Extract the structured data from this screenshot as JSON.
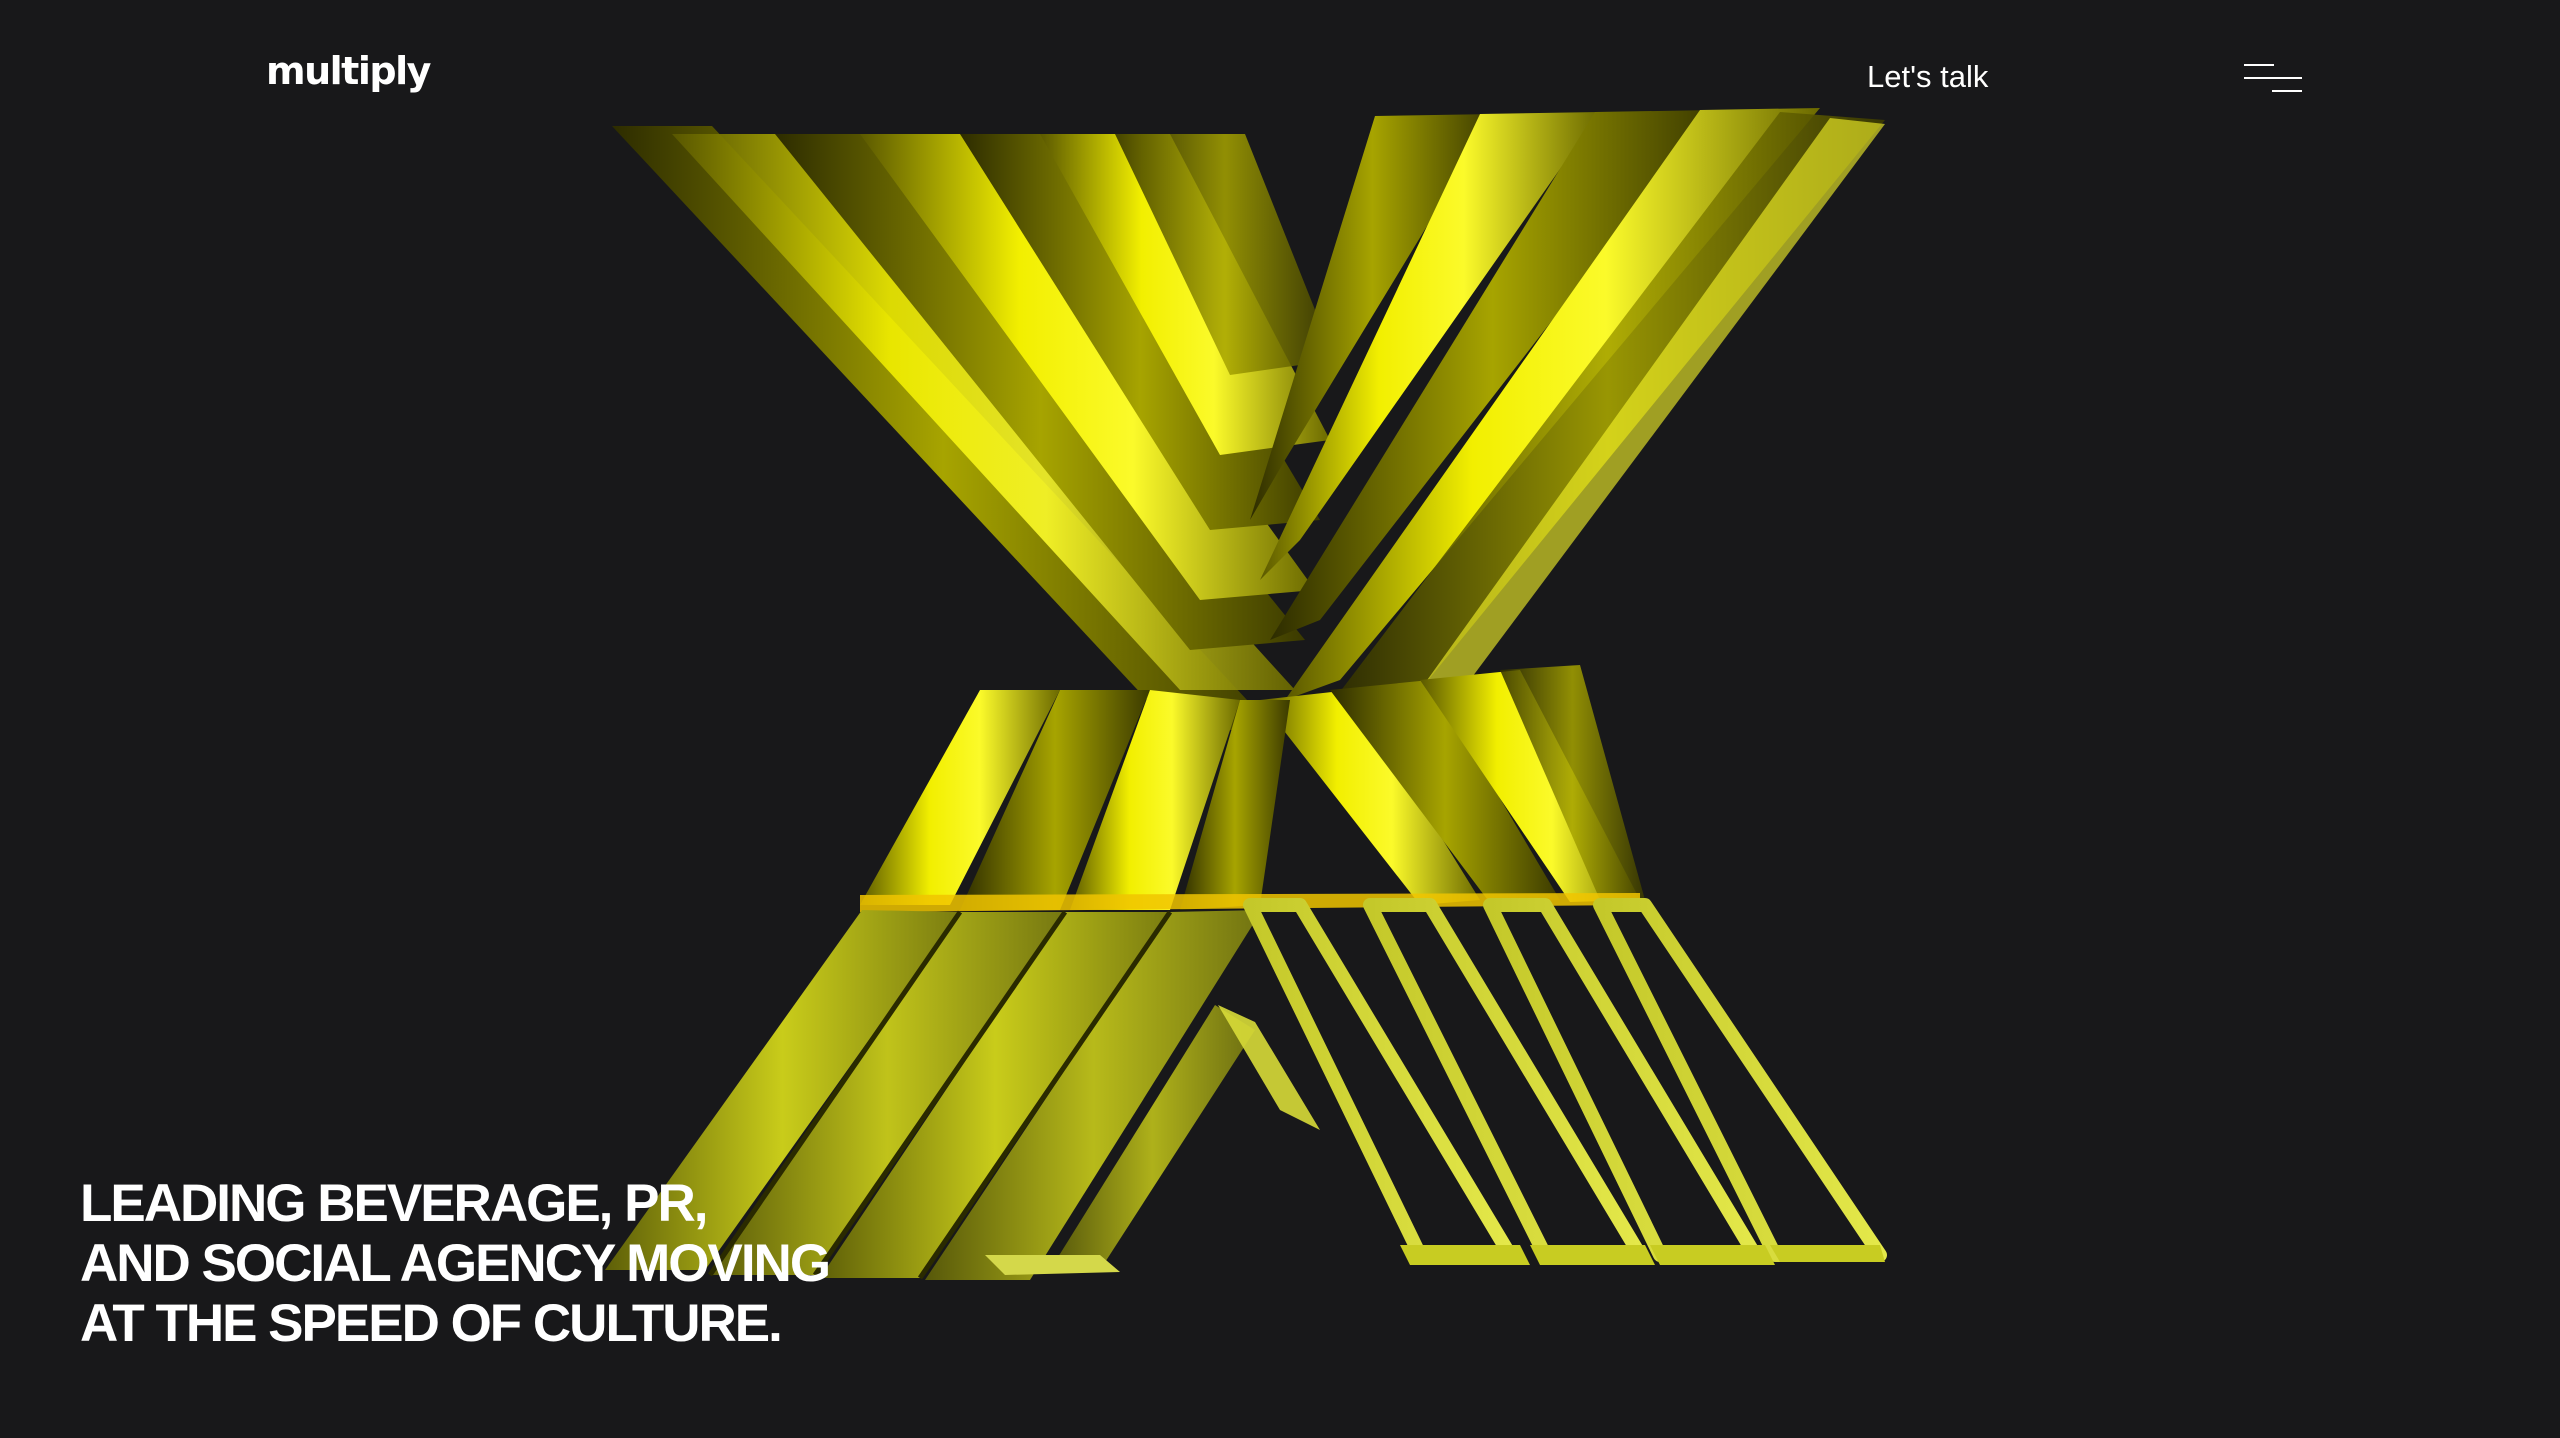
{
  "header": {
    "logo_text": "multiply",
    "cta_label": "Let's talk",
    "menu_icon": "hamburger-menu-icon"
  },
  "hero": {
    "graphic": "yellow-3d-x-icon",
    "tagline_lines": [
      "LEADING BEVERAGE, PR,",
      "AND SOCIAL AGENCY MOVING",
      "AT THE SPEED OF CULTURE."
    ]
  },
  "colors": {
    "background": "#18181a",
    "accent_yellow": "#f5f000",
    "text": "#ffffff"
  }
}
